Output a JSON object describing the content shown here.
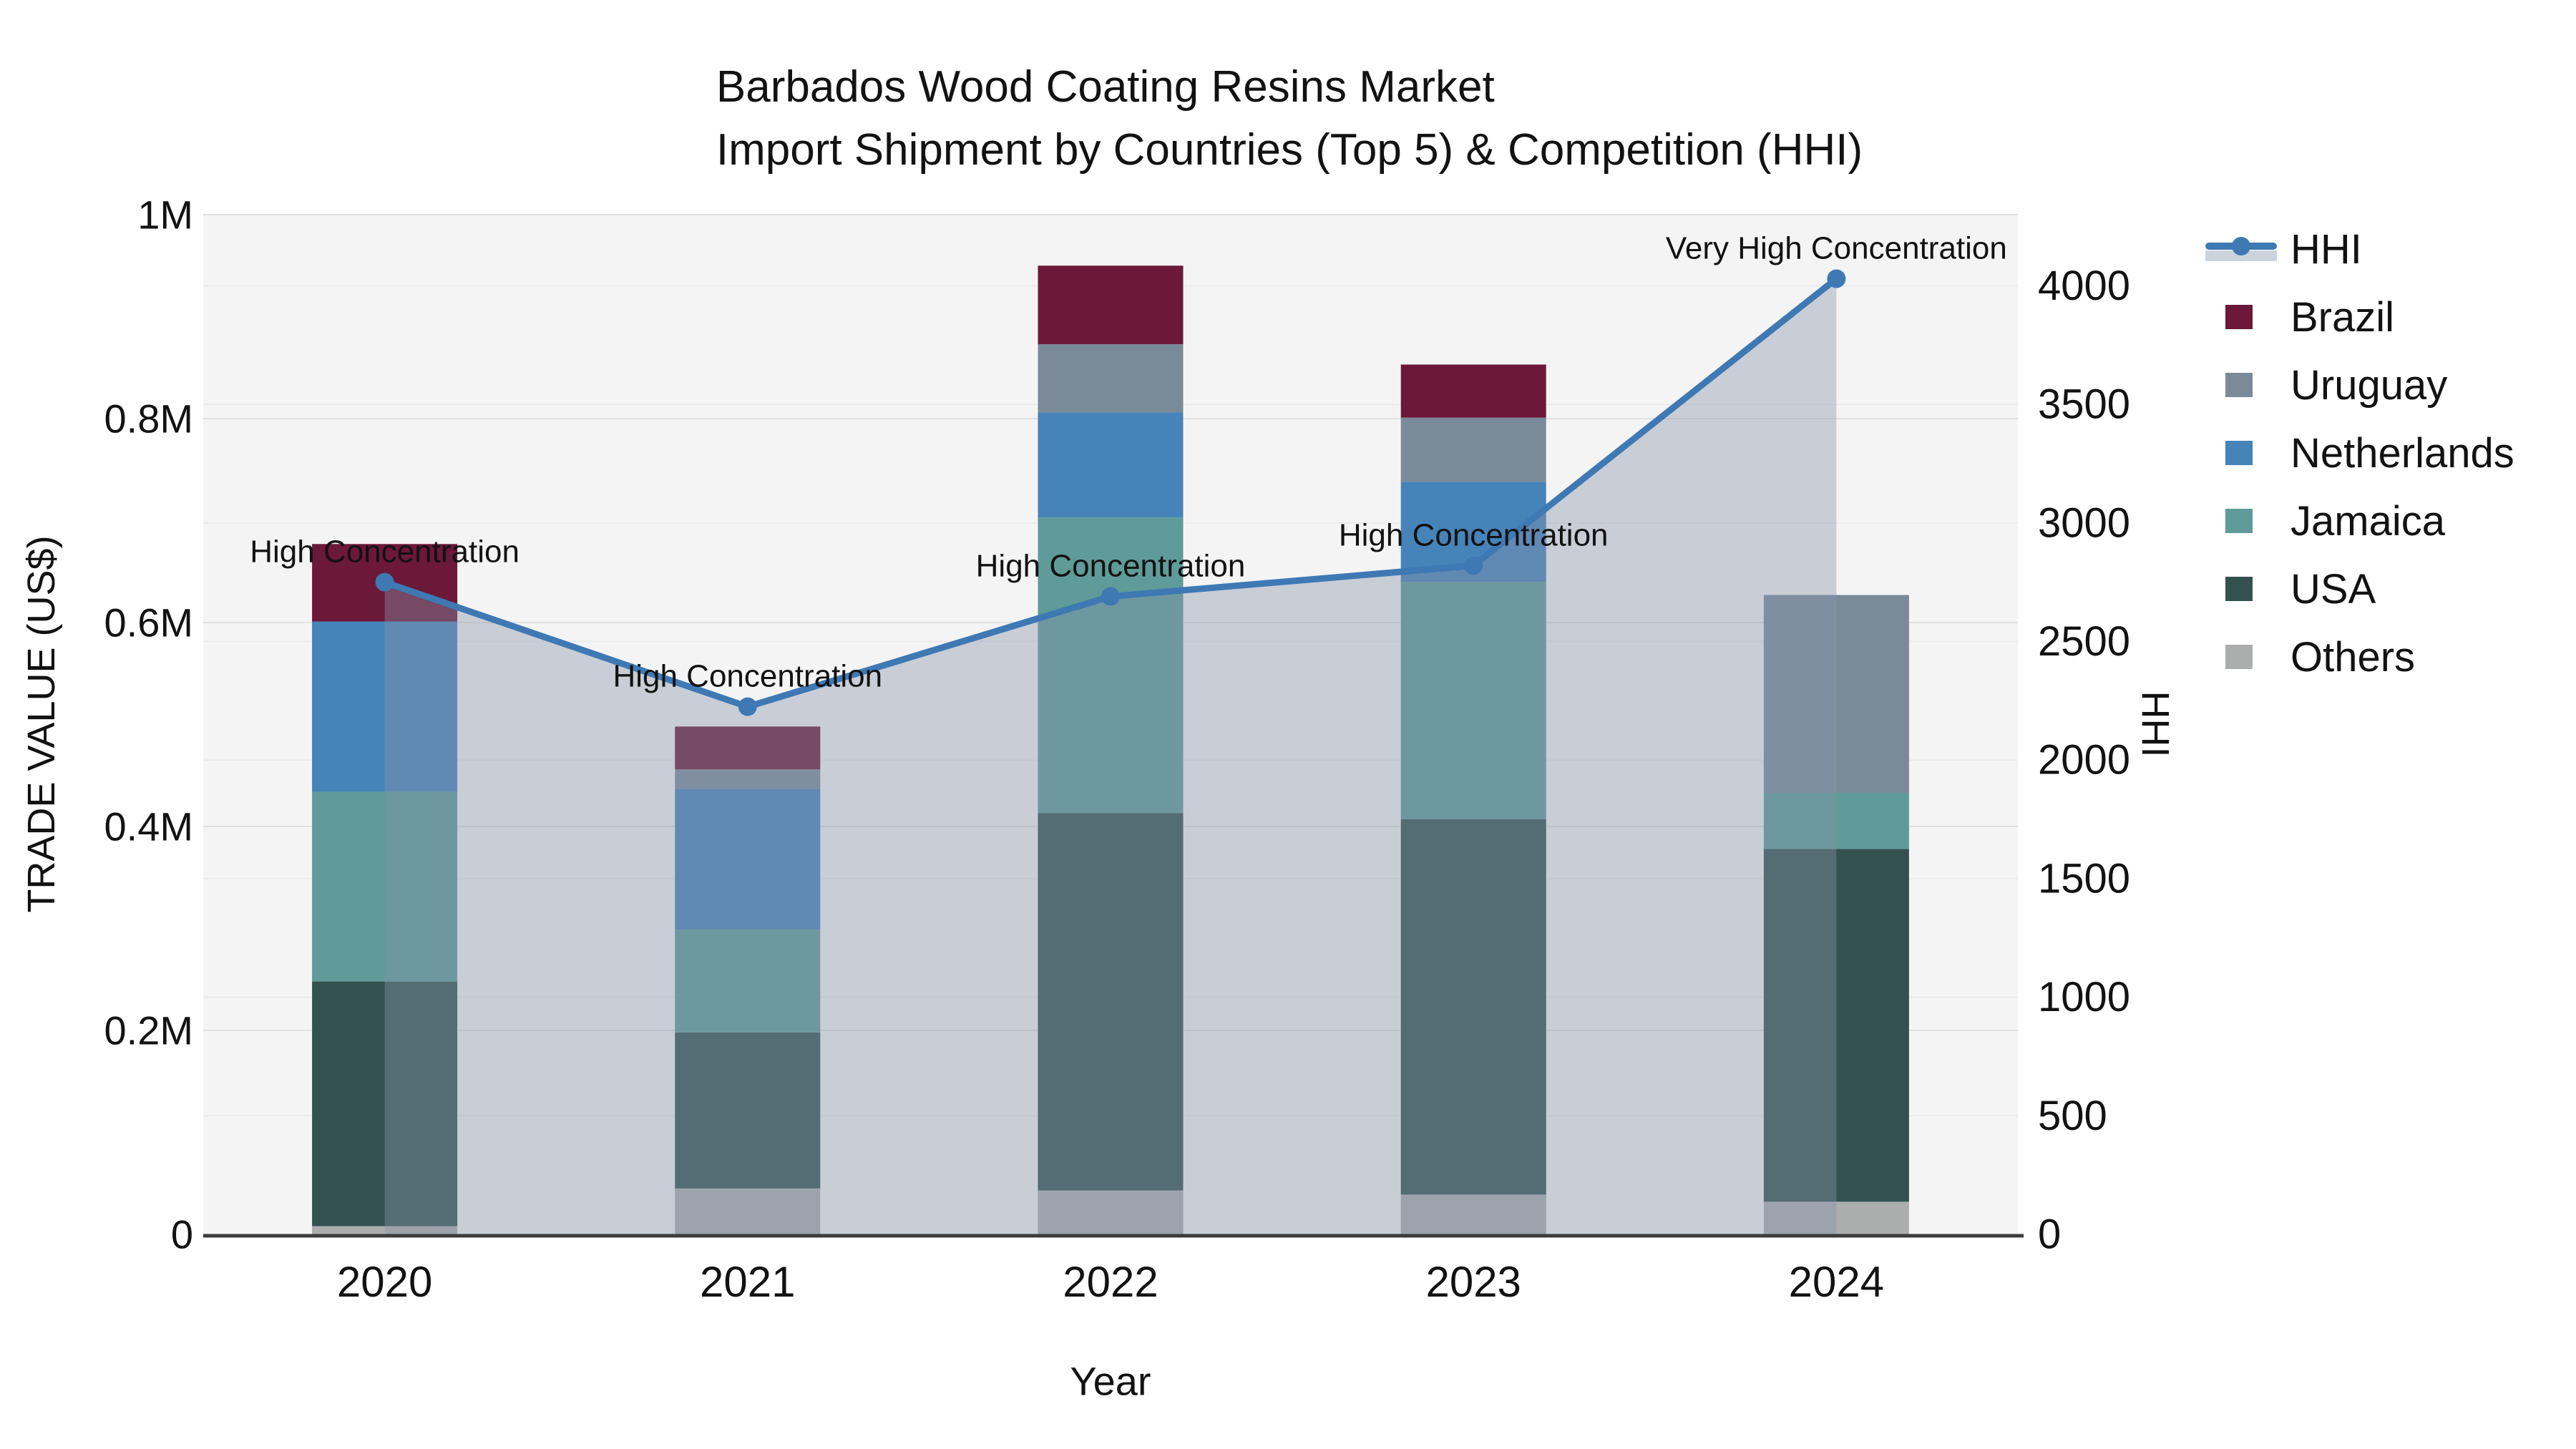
{
  "title": {
    "line1": "Barbados Wood Coating Resins Market",
    "line2": "Import Shipment by Countries (Top 5) & Competition (HHI)"
  },
  "axes": {
    "left": {
      "title": "TRADE VALUE (US$)",
      "ticks": [
        {
          "label": "0",
          "value": 0
        },
        {
          "label": "0.2M",
          "value": 200000
        },
        {
          "label": "0.4M",
          "value": 400000
        },
        {
          "label": "0.6M",
          "value": 600000
        },
        {
          "label": "0.8M",
          "value": 800000
        },
        {
          "label": "1M",
          "value": 1000000
        }
      ]
    },
    "right": {
      "title": "HHI",
      "ticks": [
        {
          "label": "0",
          "value": 0
        },
        {
          "label": "500",
          "value": 500
        },
        {
          "label": "1000",
          "value": 1000
        },
        {
          "label": "1500",
          "value": 1500
        },
        {
          "label": "2000",
          "value": 2000
        },
        {
          "label": "2500",
          "value": 2500
        },
        {
          "label": "3000",
          "value": 3000
        },
        {
          "label": "3500",
          "value": 3500
        },
        {
          "label": "4000",
          "value": 4000
        }
      ]
    },
    "x": {
      "title": "Year"
    }
  },
  "colors": {
    "HHI": "#3E79B4",
    "Brazil": "#6C1838",
    "Uruguay": "#7B8A99",
    "Netherlands": "#4683B9",
    "Jamaica": "#5E9B99",
    "USA": "#33524F",
    "Others": "#ACAEAD",
    "area_fill": "rgba(134,148,170,0.40)",
    "hhi_band": "#CCD3DC",
    "plot_bg": "#F4F4F4",
    "grid_major": "#E1E1E1",
    "grid_minor": "#EBEBEB",
    "axis_line": "#3C3C3C",
    "text": "#121212"
  },
  "legend": {
    "items": [
      {
        "label": "HHI",
        "type": "line",
        "color_key": "HHI"
      },
      {
        "label": "Brazil",
        "type": "swatch",
        "color_key": "Brazil"
      },
      {
        "label": "Uruguay",
        "type": "swatch",
        "color_key": "Uruguay"
      },
      {
        "label": "Netherlands",
        "type": "swatch",
        "color_key": "Netherlands"
      },
      {
        "label": "Jamaica",
        "type": "swatch",
        "color_key": "Jamaica"
      },
      {
        "label": "USA",
        "type": "swatch",
        "color_key": "USA"
      },
      {
        "label": "Others",
        "type": "swatch",
        "color_key": "Others"
      }
    ]
  },
  "chart_data": {
    "type": "bar+line",
    "title": "Barbados Wood Coating Resins Market — Import Shipment by Countries (Top 5) & Competition (HHI)",
    "categories": [
      "2020",
      "2021",
      "2022",
      "2023",
      "2024"
    ],
    "xlabel": "Year",
    "ylabel_left": "TRADE VALUE (US$)",
    "ylabel_right": "HHI",
    "ylim_left": [
      0,
      1000000
    ],
    "ylim_right_labeled": [
      0,
      4000
    ],
    "ylim_right_effective": [
      0,
      4300
    ],
    "grid": "on",
    "legend_position": "right",
    "stack_order_bottom_to_top": [
      "Others",
      "USA",
      "Jamaica",
      "Netherlands",
      "Uruguay",
      "Brazil"
    ],
    "series": [
      {
        "name": "Others",
        "values": [
          8000,
          45000,
          43000,
          39000,
          32000
        ]
      },
      {
        "name": "USA",
        "values": [
          240000,
          153000,
          370000,
          368000,
          346000
        ]
      },
      {
        "name": "Jamaica",
        "values": [
          186000,
          101000,
          290000,
          233000,
          55000
        ]
      },
      {
        "name": "Netherlands",
        "values": [
          167000,
          138000,
          103000,
          98000,
          0
        ]
      },
      {
        "name": "Uruguay",
        "values": [
          0,
          19000,
          67000,
          63000,
          194000
        ]
      },
      {
        "name": "Brazil",
        "values": [
          76000,
          42000,
          77000,
          52000,
          0
        ]
      }
    ],
    "bar_totals": [
      677000,
      498000,
      950000,
      853000,
      627000
    ],
    "line": {
      "name": "HHI",
      "axis": "right",
      "values": [
        2750,
        2225,
        2690,
        2820,
        4030
      ]
    },
    "annotations": [
      {
        "x": "2020",
        "text": "High Concentration"
      },
      {
        "x": "2021",
        "text": "High Concentration"
      },
      {
        "x": "2022",
        "text": "High Concentration"
      },
      {
        "x": "2023",
        "text": "High Concentration"
      },
      {
        "x": "2024",
        "text": "Very High Concentration"
      }
    ]
  }
}
